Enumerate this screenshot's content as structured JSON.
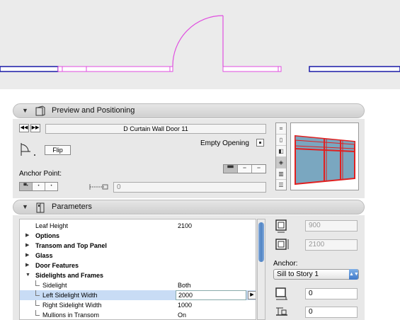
{
  "colors": {
    "wall_blue": "#1a1aa8",
    "door_magenta": "#e04ee0",
    "glass": "#7aa7c0",
    "frame_red": "#e02020",
    "selection": "#c8dcf5"
  },
  "preview_panel": {
    "title": "Preview and Positioning",
    "nav_prev": "◀◀",
    "nav_next": "▶▶",
    "object_name": "D Curtain Wall Door 11",
    "flip_label": "Flip",
    "empty_opening_label": "Empty Opening",
    "anchor_point_label": "Anchor Point:",
    "anchor_value": "0",
    "side_tools": [
      "plan-icon",
      "elevation-icon",
      "section-icon",
      "3d-icon",
      "door-icon",
      "list-icon"
    ]
  },
  "parameters_panel": {
    "title": "Parameters",
    "rows": [
      {
        "name": "Leaf Height",
        "value": "2100",
        "type": "value"
      },
      {
        "name": "Options",
        "value": "",
        "type": "group"
      },
      {
        "name": "Transom and Top Panel",
        "value": "",
        "type": "group"
      },
      {
        "name": "Glass",
        "value": "",
        "type": "group"
      },
      {
        "name": "Door Features",
        "value": "",
        "type": "group"
      },
      {
        "name": "Sidelights and Frames",
        "value": "",
        "type": "group-open"
      },
      {
        "name": "Sidelight",
        "value": "Both",
        "type": "child"
      },
      {
        "name": "Left Sidelight Width",
        "value": "2000",
        "type": "child-selected"
      },
      {
        "name": "Right Sidelight Width",
        "value": "1000",
        "type": "child"
      },
      {
        "name": "Mullions in Transom",
        "value": "On",
        "type": "child"
      }
    ],
    "right": {
      "width_value": "900",
      "height_value": "2100",
      "anchor_label": "Anchor:",
      "anchor_select": "Sill to Story 1",
      "sill_value": "0",
      "offset_value": "0"
    }
  }
}
